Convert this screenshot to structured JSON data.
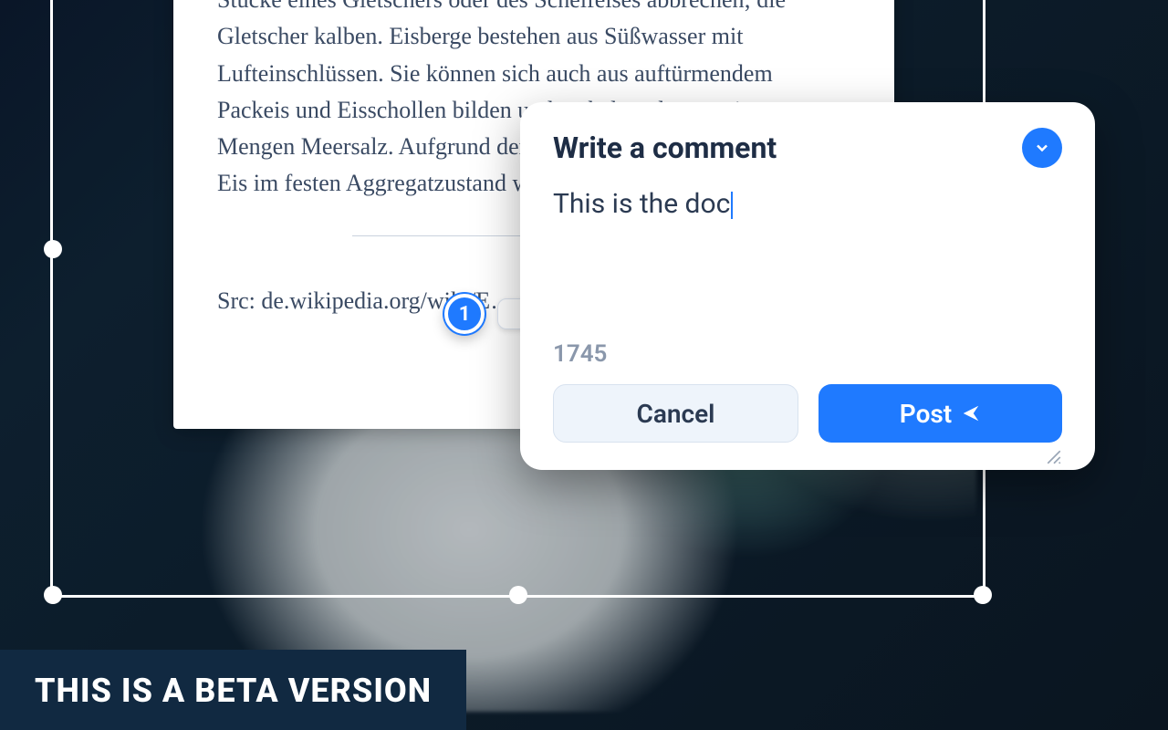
{
  "document": {
    "body_text": "Stücke eines Gletschers oder des Schelfeises abbrechen; die Gletscher kalben. Eisberge bestehen aus Süßwasser mit Lufteinschlüssen. Sie können sich auch aus auftürmendem Packeis und Eisschollen bilden und enthalten dann geringe Mengen Meersalz. Aufgrund der Dichteanomalie des Wassers ist Eis im festen Aggregatzustand weniger dicht …",
    "source_text": "Src: de.wikipedia.org/wiki/E…"
  },
  "pin": {
    "number": "1"
  },
  "comment": {
    "title": "Write a comment",
    "input_value": "This is the doc",
    "char_count": "1745",
    "cancel_label": "Cancel",
    "post_label": "Post"
  },
  "banner": {
    "text": "THIS IS A BETA VERSION"
  },
  "colors": {
    "primary": "#1f7aff"
  }
}
